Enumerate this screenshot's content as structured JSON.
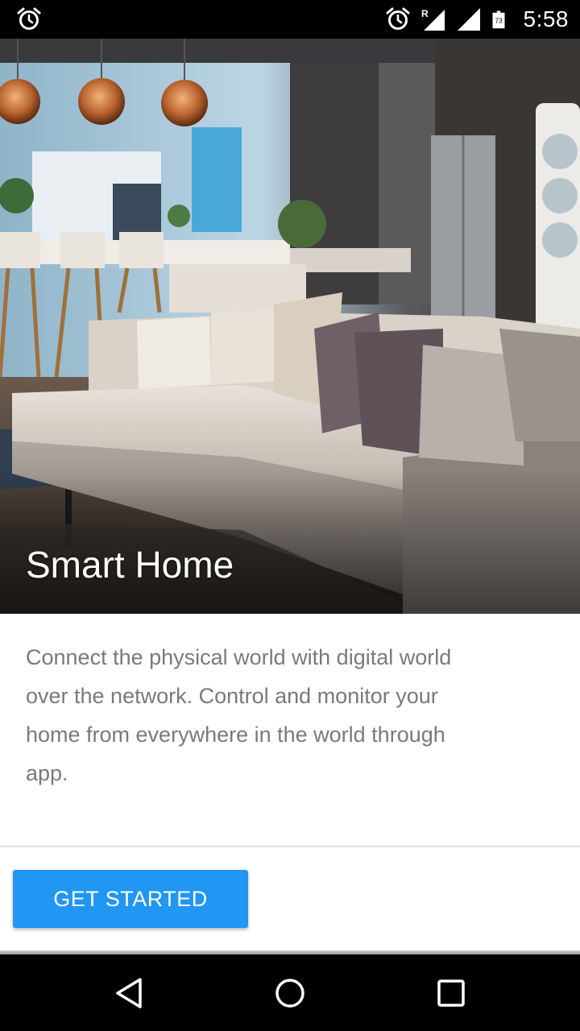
{
  "status_bar": {
    "time": "5:58",
    "battery_level": "73",
    "roaming_indicator": "R",
    "icons": [
      "alarm-icon",
      "alarm-icon",
      "signal-roaming-icon",
      "signal-icon",
      "battery-icon"
    ]
  },
  "hero": {
    "title": "Smart Home",
    "image": "living-room-photo"
  },
  "description": "Connect the physical world with digital world over the network. Control and monitor your home from everywhere in the world through app.",
  "actions": {
    "get_started_label": "GET STARTED"
  },
  "colors": {
    "accent": "#2196f3",
    "description_text": "#7a7a7a"
  },
  "nav_bar": {
    "icons": [
      "back-icon",
      "home-icon",
      "recents-icon"
    ]
  }
}
